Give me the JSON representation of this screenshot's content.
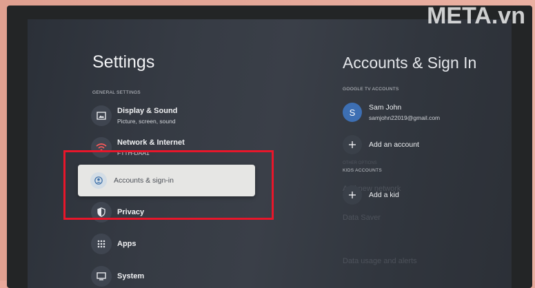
{
  "watermark": "META.vn",
  "settings": {
    "title": "Settings",
    "section": "GENERAL SETTINGS",
    "items": [
      {
        "icon": "display-icon",
        "label": "Display & Sound",
        "sub": "Picture, screen, sound"
      },
      {
        "icon": "network-icon",
        "label": "Network & Internet",
        "sub": "FTTH-DAA1"
      },
      {
        "icon": "account-icon",
        "label": "Accounts & sign-in",
        "selected": true
      },
      {
        "icon": "shield-icon",
        "label": "Privacy"
      },
      {
        "icon": "apps-grid-icon",
        "label": "Apps"
      },
      {
        "icon": "tv-icon",
        "label": "System"
      }
    ]
  },
  "accounts": {
    "title": "Accounts & Sign In",
    "google_section": "GOOGLE TV ACCOUNTS",
    "user": {
      "initial": "S",
      "name": "Sam John",
      "email": "samjohn22019@gmail.com"
    },
    "add_account": "Add an account",
    "kids_section": "KIDS ACCOUNTS",
    "add_kid": "Add a kid"
  },
  "ghost": {
    "other_options": "OTHER OPTIONS",
    "add_network": "Add new network",
    "data_saver": "Data Saver",
    "data_usage": "Data usage and alerts"
  },
  "colors": {
    "highlight_box": "#e8162a",
    "avatar": "#3d6fb3"
  }
}
